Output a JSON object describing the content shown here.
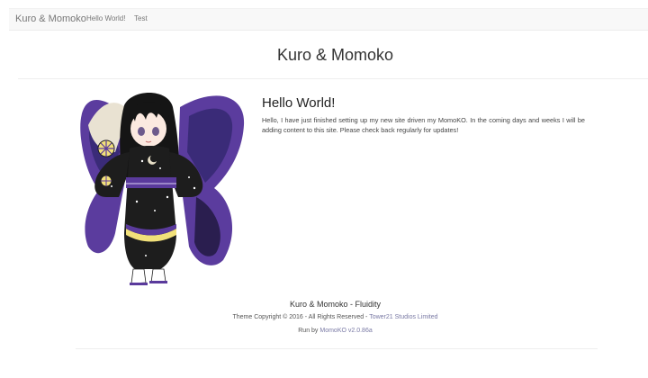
{
  "navbar": {
    "brand": "Kuro & Momoko",
    "links": [
      "Hello World!",
      "Test"
    ]
  },
  "site_title": "Kuro & Momoko",
  "post": {
    "title": "Hello World!",
    "body": "Hello, I have just finished setting up my new site driven my MomoKO. In the coming days and weeks I will be adding content to this site. Please check back regularly for updates!"
  },
  "footer": {
    "title": "Kuro & Momoko - Fluidity",
    "copyright_prefix": "Theme Copyright © 2016 - All Rights Reserved - ",
    "copyright_link": "Tower21 Studios Limited",
    "run_prefix": "Run by ",
    "run_link": "MomoKO v2.0.86a"
  },
  "colors": {
    "wing_purple": "#5b3c9e",
    "wing_dark": "#2a1e4f",
    "kimono_black": "#1d1d1d",
    "obi_purple": "#5a3a9c",
    "obi_yellow": "#f1e07a",
    "link": "#7a7aa5"
  },
  "figure_icon": "anime-girl-butterfly-illustration"
}
